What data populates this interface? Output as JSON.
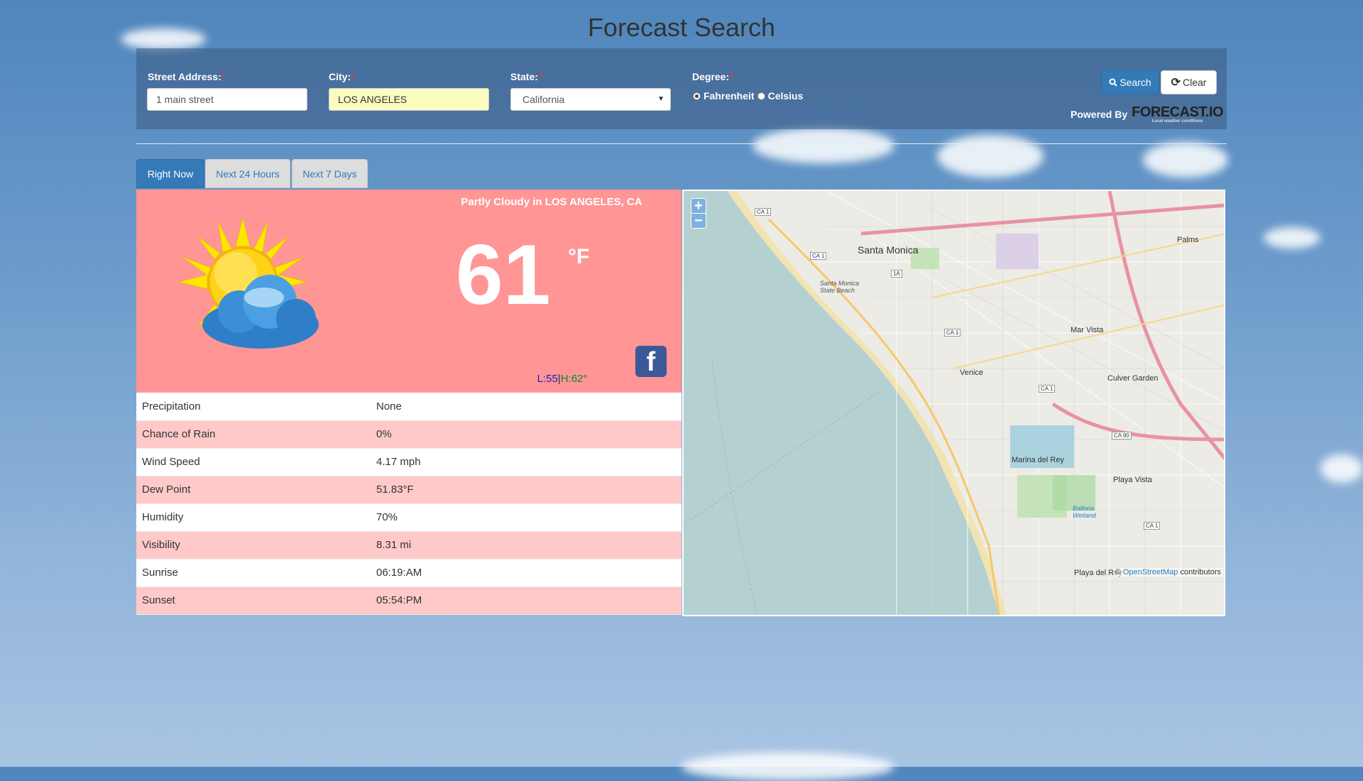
{
  "page_title": "Forecast Search",
  "form": {
    "street_label": "Street Address:",
    "street_value": "1 main street",
    "city_label": "City:",
    "city_value": "LOS ANGELES",
    "state_label": "State:",
    "state_value": "California",
    "degree_label": "Degree:",
    "required_mark": "*",
    "fahrenheit_label": "Fahrenheit",
    "celsius_label": "Celsius",
    "selected_degree": "Fahrenheit",
    "search_label": "Search",
    "clear_label": "Clear",
    "powered_by": "Powered By",
    "brand": "FORECAST.IO",
    "brand_tagline": "Local weather conditions"
  },
  "tabs": [
    "Right Now",
    "Next 24 Hours",
    "Next 7 Days"
  ],
  "active_tab": "Right Now",
  "current": {
    "summary": "Partly Cloudy in LOS ANGELES, CA",
    "temperature": "61",
    "unit": "°F",
    "low": "L:55",
    "separator": "|",
    "high": "H:62°",
    "icon": "partly-cloudy-day-icon",
    "card_color": "#ff9595"
  },
  "details": [
    {
      "label": "Precipitation",
      "value": "None"
    },
    {
      "label": "Chance of Rain",
      "value": "0%"
    },
    {
      "label": "Wind Speed",
      "value": "4.17 mph"
    },
    {
      "label": "Dew Point",
      "value": "51.83°F"
    },
    {
      "label": "Humidity",
      "value": "70%"
    },
    {
      "label": "Visibility",
      "value": "8.31 mi"
    },
    {
      "label": "Sunrise",
      "value": "06:19:AM"
    },
    {
      "label": "Sunset",
      "value": "05:54:PM"
    }
  ],
  "map": {
    "zoom_in": "+",
    "zoom_out": "−",
    "attribution_prefix": "© ",
    "attribution_link": "OpenStreetMap",
    "attribution_suffix": " contributors",
    "places": [
      "Santa Monica",
      "Mar Vista",
      "Venice",
      "Culver Garden",
      "Marina del Rey",
      "Playa Vista",
      "Palms",
      "Playa del Rey",
      "Santa Monica State Beach",
      "Ballona Wetland"
    ],
    "highways": [
      "CA 1",
      "CA 90",
      "1A"
    ]
  }
}
